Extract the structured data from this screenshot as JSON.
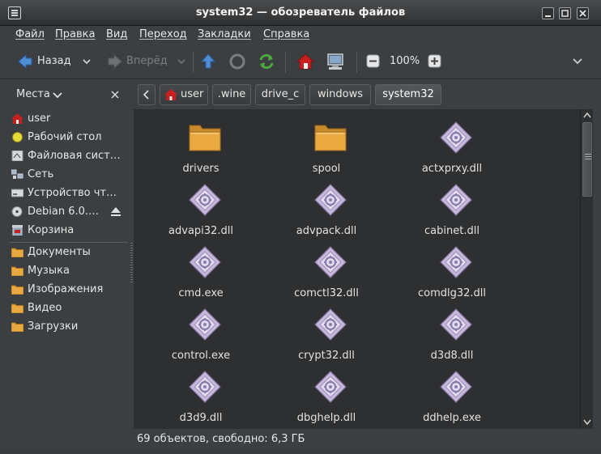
{
  "window": {
    "title": "system32 — обозреватель файлов"
  },
  "menubar": {
    "items": [
      "Файл",
      "Правка",
      "Вид",
      "Переход",
      "Закладки",
      "Справка"
    ]
  },
  "toolbar": {
    "back_label": "Назад",
    "forward_label": "Вперёд",
    "zoom_level": "100%"
  },
  "sidebar": {
    "header": "Места",
    "devices": [
      {
        "label": "user",
        "icon": "home-icon"
      },
      {
        "label": "Рабочий стол",
        "icon": "desktop-icon"
      },
      {
        "label": "Файловая сист…",
        "icon": "filesystem-icon"
      },
      {
        "label": "Сеть",
        "icon": "network-icon"
      },
      {
        "label": "Устройство чт…",
        "icon": "drive-icon"
      },
      {
        "label": "Debian 6.0.…",
        "icon": "cdrom-icon"
      },
      {
        "label": "Корзина",
        "icon": "trash-icon"
      }
    ],
    "bookmarks": [
      {
        "label": "Документы",
        "icon": "folder-icon"
      },
      {
        "label": "Музыка",
        "icon": "folder-icon"
      },
      {
        "label": "Изображения",
        "icon": "folder-icon"
      },
      {
        "label": "Видео",
        "icon": "folder-icon"
      },
      {
        "label": "Загрузки",
        "icon": "folder-icon"
      }
    ]
  },
  "breadcrumb": {
    "segments": [
      "user",
      ".wine",
      "drive_c",
      "windows",
      "system32"
    ]
  },
  "files": [
    {
      "name": "drivers",
      "type": "folder"
    },
    {
      "name": "spool",
      "type": "folder"
    },
    {
      "name": "actxprxy.dll",
      "type": "executable"
    },
    {
      "name": "advapi32.dll",
      "type": "executable"
    },
    {
      "name": "advpack.dll",
      "type": "executable"
    },
    {
      "name": "cabinet.dll",
      "type": "executable"
    },
    {
      "name": "cmd.exe",
      "type": "executable"
    },
    {
      "name": "comctl32.dll",
      "type": "executable"
    },
    {
      "name": "comdlg32.dll",
      "type": "executable"
    },
    {
      "name": "control.exe",
      "type": "executable"
    },
    {
      "name": "crypt32.dll",
      "type": "executable"
    },
    {
      "name": "d3d8.dll",
      "type": "executable"
    },
    {
      "name": "d3d9.dll",
      "type": "executable"
    },
    {
      "name": "dbghelp.dll",
      "type": "executable"
    },
    {
      "name": "ddhelp.exe",
      "type": "executable"
    }
  ],
  "statusbar": {
    "text": "69 объектов, свободно: 6,3 ГБ"
  },
  "colors": {
    "folder": "#e9a840",
    "executable": "#c6b8dd",
    "home_red": "#c8201f",
    "arrow_blue": "#4f8fd8",
    "refresh_green": "#4caa3a"
  }
}
